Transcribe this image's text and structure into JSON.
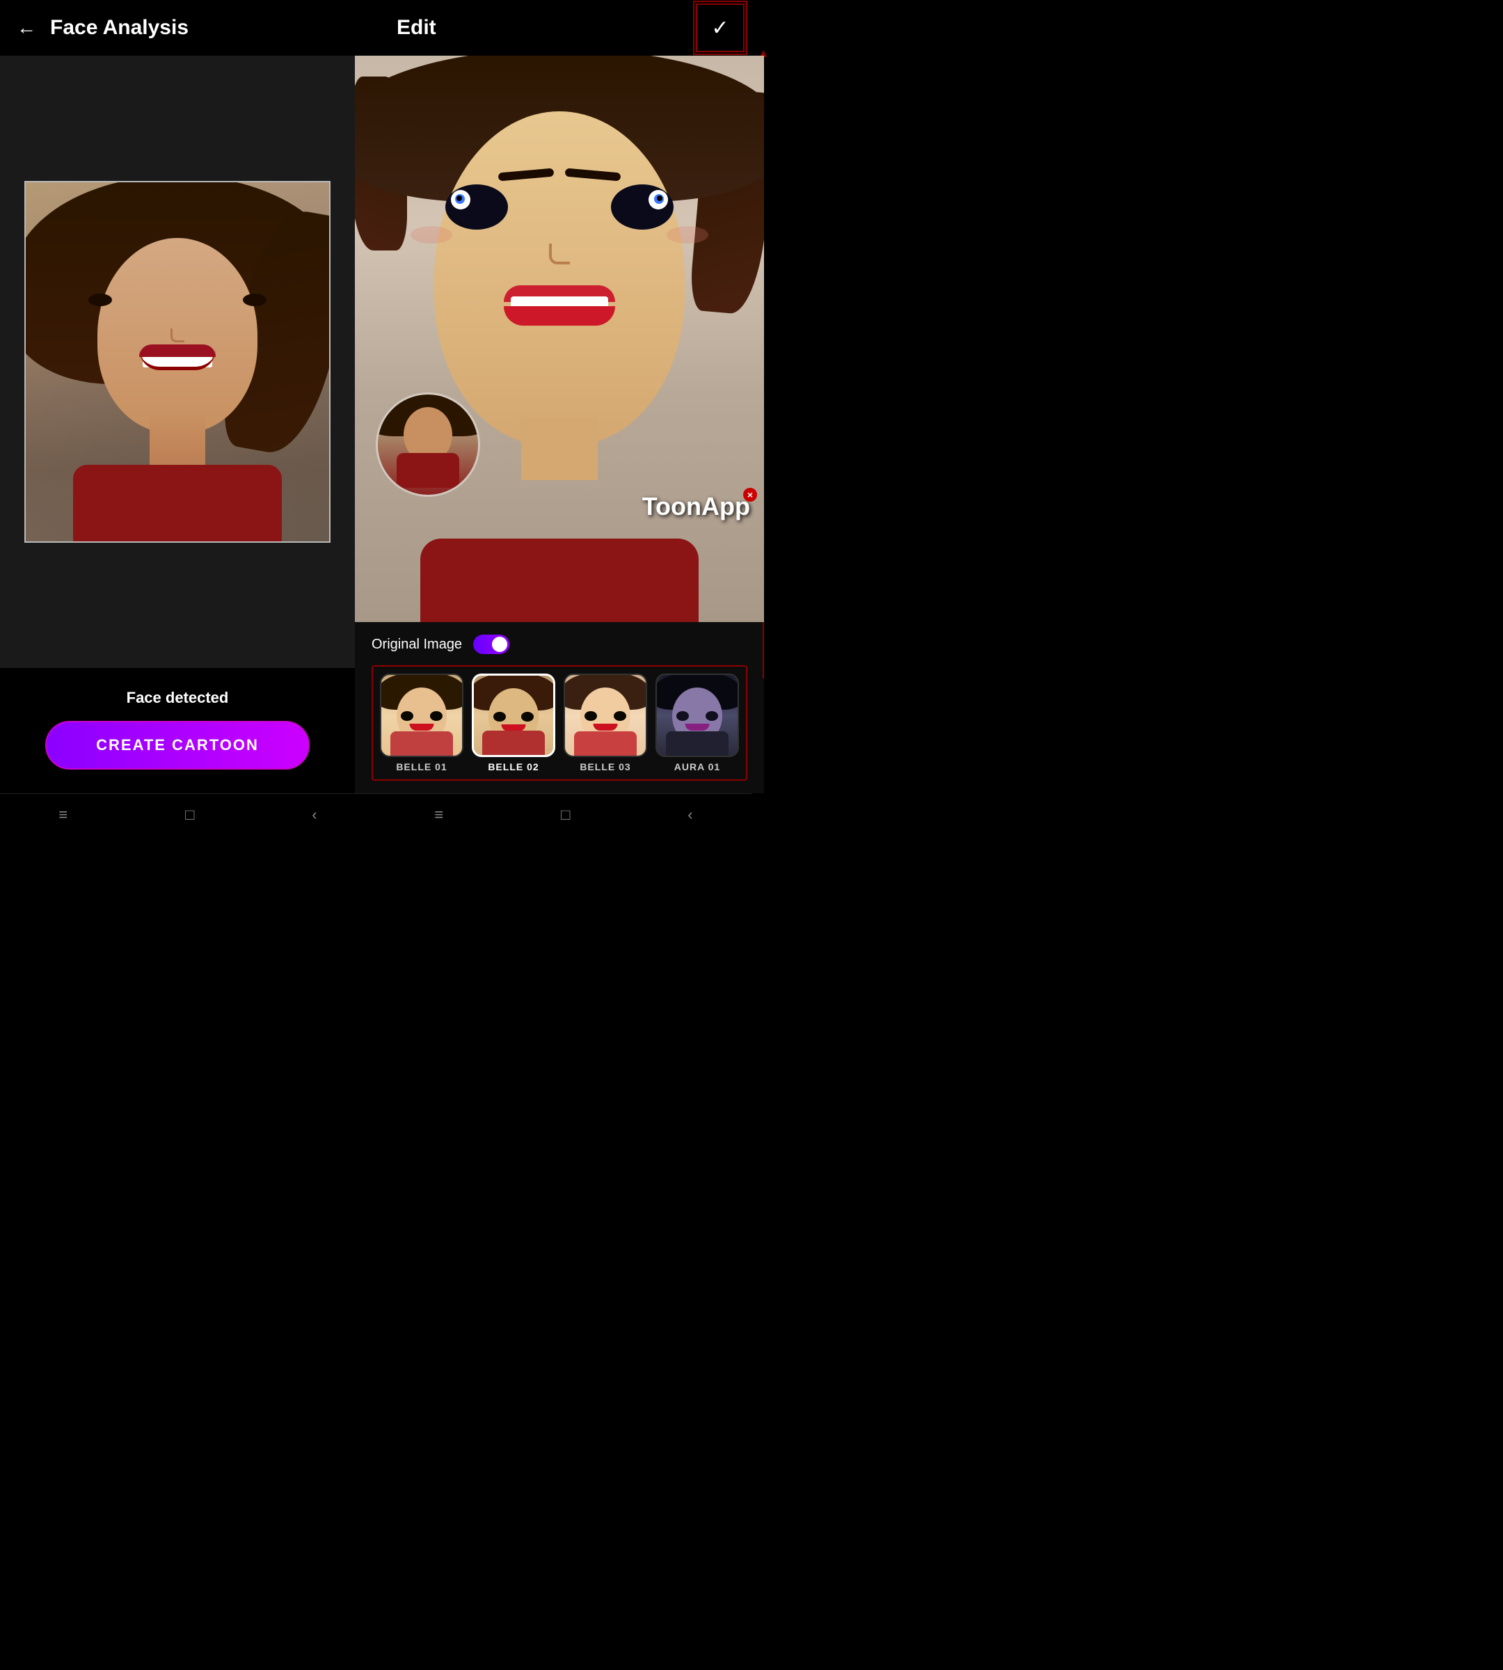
{
  "leftPanel": {
    "header": {
      "backArrow": "←",
      "title": "Face Analysis"
    },
    "faceDetectedText": "Face detected",
    "createButton": "CREATE CARTOON"
  },
  "rightPanel": {
    "header": {
      "backArrow": "←",
      "title": "Edit",
      "checkIcon": "✓"
    },
    "originalImageLabel": "Original Image",
    "toggleOn": true,
    "watermark": "ToonApp",
    "filters": [
      {
        "id": "belle01",
        "label": "BELLE 01",
        "active": false,
        "hairColor": "#3d2010",
        "skinColor": "#e8c090",
        "bodyColor": "#c04040"
      },
      {
        "id": "belle02",
        "label": "BELLE 02",
        "active": true,
        "hairColor": "#3d2010",
        "skinColor": "#ddb880",
        "bodyColor": "#b03030"
      },
      {
        "id": "belle03",
        "label": "BELLE 03",
        "active": false,
        "hairColor": "#4a2a10",
        "skinColor": "#f0cca0",
        "bodyColor": "#c84040"
      },
      {
        "id": "aura01",
        "label": "AURA 01",
        "active": false,
        "hairColor": "#101018",
        "skinColor": "#8878a8",
        "bodyColor": "#202030"
      }
    ]
  },
  "bottomNav": {
    "leftNav": [
      "≡",
      "□",
      "‹"
    ],
    "rightNav": [
      "≡",
      "□",
      "‹"
    ]
  },
  "annotations": {
    "redBoxCheckButton": true,
    "redVerticalArrow": true,
    "redHorizontalArrow": true
  }
}
